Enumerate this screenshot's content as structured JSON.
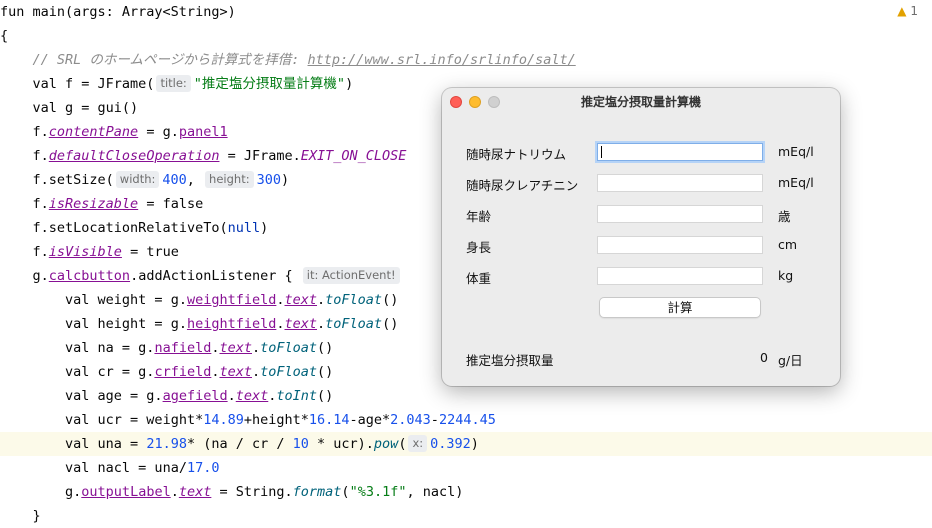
{
  "editor": {
    "warning_count": "1",
    "lines": {
      "l1": "fun main(args: Array<String>)",
      "l2": "{",
      "l3_comment": "// SRL のホームページから計算式を拝借: ",
      "l3_url": "http://www.srl.info/srlinfo/salt/",
      "l4_a": "val f = JFrame(",
      "l4_hint": "title:",
      "l4_str": "\"推定塩分摂取量計算機\"",
      "l4_b": ")",
      "l5": "val g = gui()",
      "l6_a": "f.",
      "l6_p1": "contentPane",
      "l6_b": " = g.",
      "l6_p2": "panel1",
      "l7_a": "f.",
      "l7_p1": "defaultCloseOperation",
      "l7_b": " = JFrame.",
      "l7_c": "EXIT_ON_CLOSE",
      "l8_a": "f.setSize(",
      "l8_h1": "width:",
      "l8_n1": "400",
      "l8_b": ",",
      "l8_h2": "height:",
      "l8_n2": "300",
      "l8_c": ")",
      "l9_a": "f.",
      "l9_p": "isResizable",
      "l9_b": " = false",
      "l10_a": "f.setLocationRelativeTo(",
      "l10_k": "null",
      "l10_b": ")",
      "l11_a": "f.",
      "l11_p": "isVisible",
      "l11_b": " = true",
      "l12_a": "g.",
      "l12_p": "calcbutton",
      "l12_b": ".addActionListener {",
      "l12_hint": "it: ActionEvent!",
      "l13_a": "val weight = g.",
      "l13_p1": "weightfield",
      "l13_b": ".",
      "l13_p2": "text",
      "l13_c": ".",
      "l13_f": "toFloat",
      "l13_d": "()",
      "l14_a": "val height = g.",
      "l14_p1": "heightfield",
      "l14_b": ".",
      "l14_p2": "text",
      "l14_c": ".",
      "l14_f": "toFloat",
      "l14_d": "()",
      "l15_a": "val na = g.",
      "l15_p1": "nafield",
      "l15_b": ".",
      "l15_p2": "text",
      "l15_c": ".",
      "l15_f": "toFloat",
      "l15_d": "()",
      "l16_a": "val cr = g.",
      "l16_p1": "crfield",
      "l16_b": ".",
      "l16_p2": "text",
      "l16_c": ".",
      "l16_f": "toFloat",
      "l16_d": "()",
      "l17_a": "val age = g.",
      "l17_p1": "agefield",
      "l17_b": ".",
      "l17_p2": "text",
      "l17_c": ".",
      "l17_f": "toInt",
      "l17_d": "()",
      "l18_a": "val ucr = weight*",
      "l18_n1": "14.89",
      "l18_b": "+height*",
      "l18_n2": "16.14",
      "l18_c": "-age*",
      "l18_n3": "2.043",
      "l18_d": "-",
      "l18_n4": "2244.45",
      "l19_a": "val una = ",
      "l19_n1": "21.98",
      "l19_b": "* (na / cr / ",
      "l19_n2": "10",
      "l19_c": " * ucr).",
      "l19_f": "pow",
      "l19_d": "(",
      "l19_hint": "x:",
      "l19_n3": "0.392",
      "l19_e": ")",
      "l20_a": "val nacl = una/",
      "l20_n": "17.0",
      "l21_a": "g.",
      "l21_p1": "outputLabel",
      "l21_b": ".",
      "l21_p2": "text",
      "l21_c": " = String.",
      "l21_f": "format",
      "l21_d": "(",
      "l21_s": "\"%3.1f\"",
      "l21_e": ", nacl)",
      "l22": "}"
    }
  },
  "window": {
    "title": "推定塩分摂取量計算機",
    "rows": [
      {
        "label": "随時尿ナトリウム",
        "unit": "mEq/l",
        "value": ""
      },
      {
        "label": "随時尿クレアチニン",
        "unit": "mEq/l",
        "value": ""
      },
      {
        "label": "年齢",
        "unit": "歳",
        "value": ""
      },
      {
        "label": "身長",
        "unit": "cm",
        "value": ""
      },
      {
        "label": "体重",
        "unit": "kg",
        "value": ""
      }
    ],
    "button_label": "計算",
    "result_label": "推定塩分摂取量",
    "result_value": "0",
    "result_unit": "g/日"
  },
  "colors": {
    "keyword": "#0033b3",
    "string": "#067d17",
    "number": "#1750eb",
    "property": "#871094",
    "comment": "#8c8c8c",
    "highlight_line": "#fcfae9"
  },
  "icons": [
    "warning-triangle-icon",
    "close-window-icon",
    "minimize-window-icon",
    "zoom-window-icon"
  ]
}
